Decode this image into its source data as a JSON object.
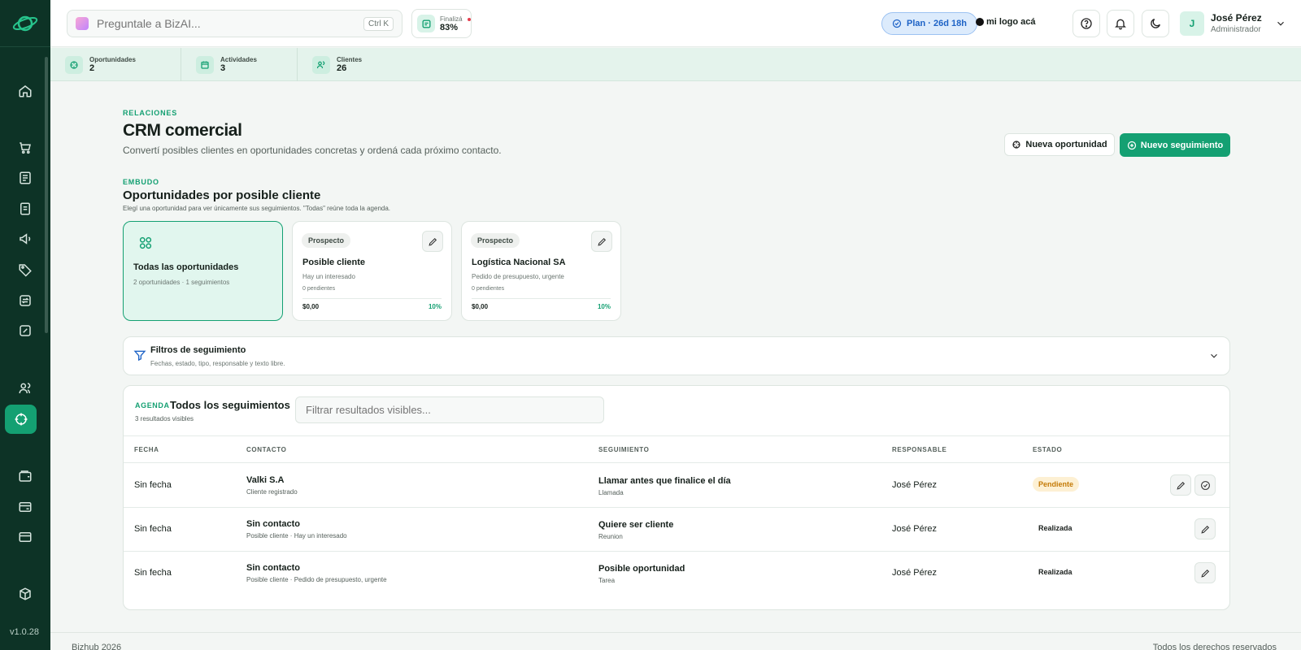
{
  "app": {
    "version": "v1.0.28",
    "search_placeholder": "Preguntale a BizAI...",
    "search_shortcut": "Ctrl K",
    "progress": {
      "label": "Finalizá",
      "value": "83%"
    },
    "plan_label": "Plan · 26d 18h",
    "logo_text": "mi logo acá",
    "user": {
      "initial": "J",
      "name": "José Pérez",
      "role": "Administrador"
    }
  },
  "stats": [
    {
      "label": "Oportunidades",
      "value": "2",
      "icon": "target-icon"
    },
    {
      "label": "Actividades",
      "value": "3",
      "icon": "calendar-icon"
    },
    {
      "label": "Clientes",
      "value": "26",
      "icon": "users-icon"
    }
  ],
  "header": {
    "eyebrow": "RELACIONES",
    "title": "CRM comercial",
    "subtitle": "Convertí posibles clientes en oportunidades concretas y ordená cada próximo contacto.",
    "btn_new_opportunity": "Nueva oportunidad",
    "btn_new_followup": "Nuevo seguimiento"
  },
  "funnel": {
    "eyebrow": "EMBUDO",
    "title": "Oportunidades por posible cliente",
    "subtitle": "Elegí una oportunidad para ver únicamente sus seguimientos. \"Todas\" reúne toda la agenda.",
    "all_card": {
      "title": "Todas las oportunidades",
      "meta": "2 oportunidades · 1 seguimientos"
    },
    "cards": [
      {
        "badge": "Prospecto",
        "title": "Posible cliente",
        "desc": "Hay un interesado",
        "pending": "0 pendientes",
        "amount": "$0,00",
        "percent": "10%"
      },
      {
        "badge": "Prospecto",
        "title": "Logística Nacional SA",
        "desc": "Pedido de presupuesto, urgente",
        "pending": "0 pendientes",
        "amount": "$0,00",
        "percent": "10%"
      }
    ]
  },
  "filters": {
    "title": "Filtros de seguimiento",
    "subtitle": "Fechas, estado, tipo, responsable y texto libre."
  },
  "agenda": {
    "eyebrow": "AGENDA",
    "title": "Todos los seguimientos",
    "count": "3 resultados visibles",
    "filter_placeholder": "Filtrar resultados visibles...",
    "columns": [
      "FECHA",
      "CONTACTO",
      "SEGUIMIENTO",
      "RESPONSABLE",
      "ESTADO"
    ],
    "rows": [
      {
        "fecha": "Sin fecha",
        "contacto": "Valki S.A",
        "contacto_sub": "Cliente registrado",
        "seguimiento": "Llamar antes que finalice el día",
        "tipo": "Llamada",
        "responsable": "José Pérez",
        "estado": "Pendiente"
      },
      {
        "fecha": "Sin fecha",
        "contacto": "Sin contacto",
        "contacto_sub": "Posible cliente · Hay un interesado",
        "seguimiento": "Quiere ser cliente",
        "tipo": "Reunion",
        "responsable": "José Pérez",
        "estado": "Realizada"
      },
      {
        "fecha": "Sin fecha",
        "contacto": "Sin contacto",
        "contacto_sub": "Posible cliente · Pedido de presupuesto, urgente",
        "seguimiento": "Posible oportunidad",
        "tipo": "Tarea",
        "responsable": "José Pérez",
        "estado": "Realizada"
      }
    ]
  },
  "footer": {
    "left": "Bizhub 2026",
    "right": "Todos los derechos reservados"
  },
  "colors": {
    "accent": "#14a072",
    "sidebar": "#0d3326",
    "pending": "#c47a06"
  }
}
